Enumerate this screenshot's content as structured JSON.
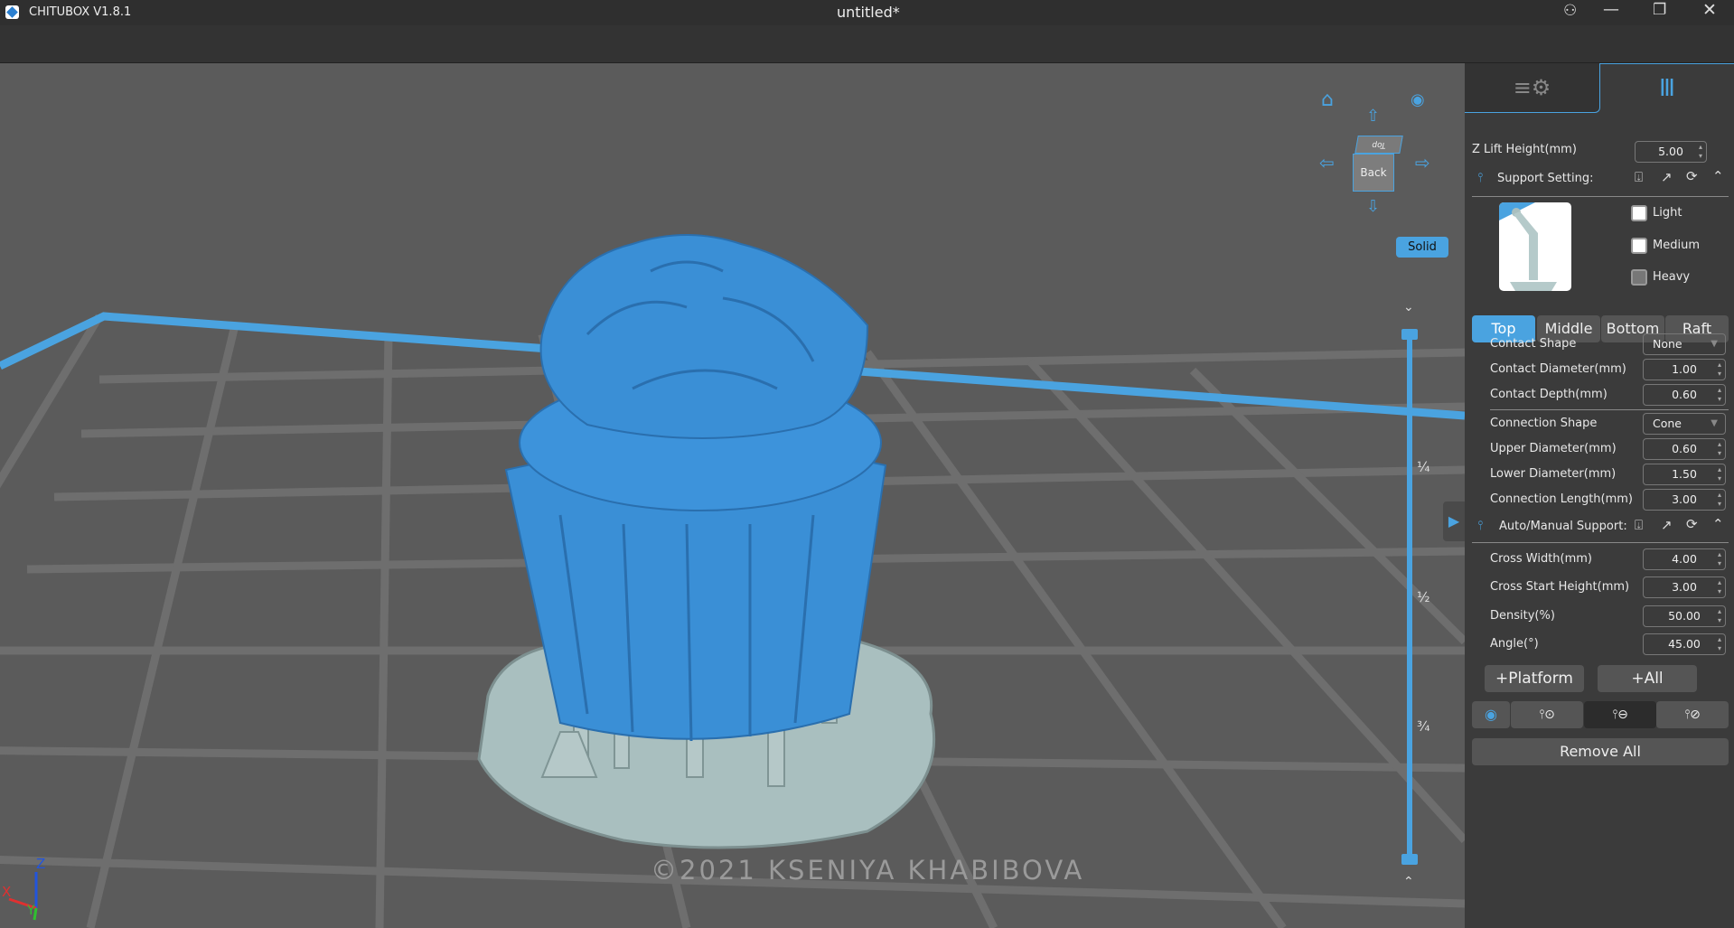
{
  "app": {
    "title": "CHITUBOX V1.8.1",
    "document": "untitled*"
  },
  "viewport": {
    "view_cube": {
      "front": "Back",
      "top": "Top"
    },
    "render_mode": "Solid",
    "layer_slider": {
      "marks": [
        "¼",
        "½",
        "¾"
      ]
    },
    "watermark": "©2021 KSENIYA KHABIBOVA",
    "axes": {
      "x": "X",
      "y": "Y",
      "z": "Z"
    }
  },
  "panel": {
    "z_lift": {
      "label": "Z Lift Height(mm)",
      "value": "5.00"
    },
    "support_setting": {
      "label": "Support Setting:"
    },
    "presets": [
      {
        "label": "Light",
        "checked": false
      },
      {
        "label": "Medium",
        "checked": false
      },
      {
        "label": "Heavy",
        "checked": false
      }
    ],
    "tabs": [
      {
        "label": "Top",
        "active": true
      },
      {
        "label": "Middle"
      },
      {
        "label": "Bottom"
      },
      {
        "label": "Raft"
      }
    ],
    "top_fields": [
      {
        "label": "Contact Shape",
        "value": "None",
        "type": "select"
      },
      {
        "label": "Contact Diameter(mm)",
        "value": "1.00"
      },
      {
        "label": "Contact Depth(mm)",
        "value": "0.60"
      }
    ],
    "connection_fields": [
      {
        "label": "Connection Shape",
        "value": "Cone",
        "type": "select"
      },
      {
        "label": "Upper Diameter(mm)",
        "value": "0.60"
      },
      {
        "label": "Lower Diameter(mm)",
        "value": "1.50"
      },
      {
        "label": "Connection Length(mm)",
        "value": "3.00"
      }
    ],
    "auto_manual": {
      "label": "Auto/Manual Support:"
    },
    "auto_fields": [
      {
        "label": "Cross Width(mm)",
        "value": "4.00"
      },
      {
        "label": "Cross Start Height(mm)",
        "value": "3.00"
      },
      {
        "label": "Density(%)",
        "value": "50.00"
      },
      {
        "label": "Angle(°)",
        "value": "45.00"
      }
    ],
    "add_platform": "+Platform",
    "add_all": "+All",
    "remove_all": "Remove All"
  },
  "colors": {
    "accent": "#4aa3e0",
    "model": "#3a8fd6",
    "support": "#a9bfbf"
  }
}
